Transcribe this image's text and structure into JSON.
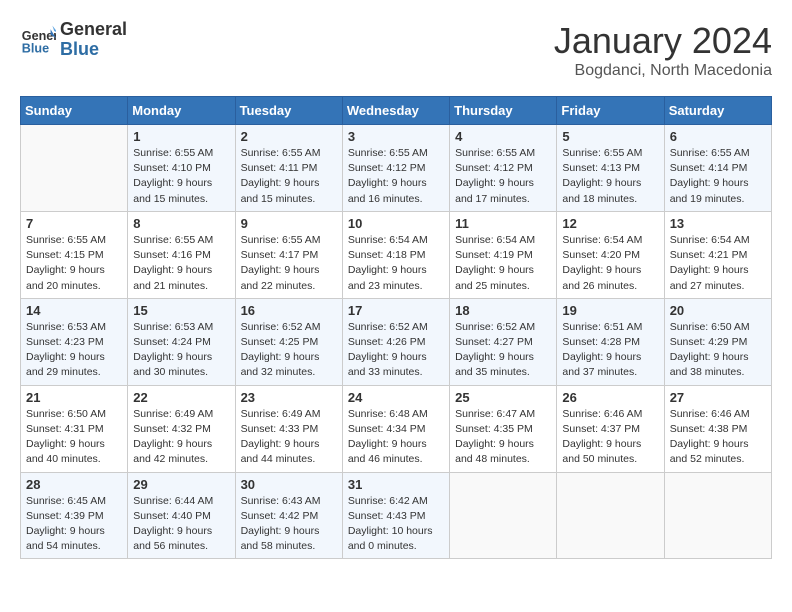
{
  "header": {
    "logo_general": "General",
    "logo_blue": "Blue",
    "title": "January 2024",
    "subtitle": "Bogdanci, North Macedonia"
  },
  "weekdays": [
    "Sunday",
    "Monday",
    "Tuesday",
    "Wednesday",
    "Thursday",
    "Friday",
    "Saturday"
  ],
  "weeks": [
    [
      {
        "day": "",
        "sunrise": "",
        "sunset": "",
        "daylight": ""
      },
      {
        "day": "1",
        "sunrise": "Sunrise: 6:55 AM",
        "sunset": "Sunset: 4:10 PM",
        "daylight": "Daylight: 9 hours and 15 minutes."
      },
      {
        "day": "2",
        "sunrise": "Sunrise: 6:55 AM",
        "sunset": "Sunset: 4:11 PM",
        "daylight": "Daylight: 9 hours and 15 minutes."
      },
      {
        "day": "3",
        "sunrise": "Sunrise: 6:55 AM",
        "sunset": "Sunset: 4:12 PM",
        "daylight": "Daylight: 9 hours and 16 minutes."
      },
      {
        "day": "4",
        "sunrise": "Sunrise: 6:55 AM",
        "sunset": "Sunset: 4:12 PM",
        "daylight": "Daylight: 9 hours and 17 minutes."
      },
      {
        "day": "5",
        "sunrise": "Sunrise: 6:55 AM",
        "sunset": "Sunset: 4:13 PM",
        "daylight": "Daylight: 9 hours and 18 minutes."
      },
      {
        "day": "6",
        "sunrise": "Sunrise: 6:55 AM",
        "sunset": "Sunset: 4:14 PM",
        "daylight": "Daylight: 9 hours and 19 minutes."
      }
    ],
    [
      {
        "day": "7",
        "sunrise": "Sunrise: 6:55 AM",
        "sunset": "Sunset: 4:15 PM",
        "daylight": "Daylight: 9 hours and 20 minutes."
      },
      {
        "day": "8",
        "sunrise": "Sunrise: 6:55 AM",
        "sunset": "Sunset: 4:16 PM",
        "daylight": "Daylight: 9 hours and 21 minutes."
      },
      {
        "day": "9",
        "sunrise": "Sunrise: 6:55 AM",
        "sunset": "Sunset: 4:17 PM",
        "daylight": "Daylight: 9 hours and 22 minutes."
      },
      {
        "day": "10",
        "sunrise": "Sunrise: 6:54 AM",
        "sunset": "Sunset: 4:18 PM",
        "daylight": "Daylight: 9 hours and 23 minutes."
      },
      {
        "day": "11",
        "sunrise": "Sunrise: 6:54 AM",
        "sunset": "Sunset: 4:19 PM",
        "daylight": "Daylight: 9 hours and 25 minutes."
      },
      {
        "day": "12",
        "sunrise": "Sunrise: 6:54 AM",
        "sunset": "Sunset: 4:20 PM",
        "daylight": "Daylight: 9 hours and 26 minutes."
      },
      {
        "day": "13",
        "sunrise": "Sunrise: 6:54 AM",
        "sunset": "Sunset: 4:21 PM",
        "daylight": "Daylight: 9 hours and 27 minutes."
      }
    ],
    [
      {
        "day": "14",
        "sunrise": "Sunrise: 6:53 AM",
        "sunset": "Sunset: 4:23 PM",
        "daylight": "Daylight: 9 hours and 29 minutes."
      },
      {
        "day": "15",
        "sunrise": "Sunrise: 6:53 AM",
        "sunset": "Sunset: 4:24 PM",
        "daylight": "Daylight: 9 hours and 30 minutes."
      },
      {
        "day": "16",
        "sunrise": "Sunrise: 6:52 AM",
        "sunset": "Sunset: 4:25 PM",
        "daylight": "Daylight: 9 hours and 32 minutes."
      },
      {
        "day": "17",
        "sunrise": "Sunrise: 6:52 AM",
        "sunset": "Sunset: 4:26 PM",
        "daylight": "Daylight: 9 hours and 33 minutes."
      },
      {
        "day": "18",
        "sunrise": "Sunrise: 6:52 AM",
        "sunset": "Sunset: 4:27 PM",
        "daylight": "Daylight: 9 hours and 35 minutes."
      },
      {
        "day": "19",
        "sunrise": "Sunrise: 6:51 AM",
        "sunset": "Sunset: 4:28 PM",
        "daylight": "Daylight: 9 hours and 37 minutes."
      },
      {
        "day": "20",
        "sunrise": "Sunrise: 6:50 AM",
        "sunset": "Sunset: 4:29 PM",
        "daylight": "Daylight: 9 hours and 38 minutes."
      }
    ],
    [
      {
        "day": "21",
        "sunrise": "Sunrise: 6:50 AM",
        "sunset": "Sunset: 4:31 PM",
        "daylight": "Daylight: 9 hours and 40 minutes."
      },
      {
        "day": "22",
        "sunrise": "Sunrise: 6:49 AM",
        "sunset": "Sunset: 4:32 PM",
        "daylight": "Daylight: 9 hours and 42 minutes."
      },
      {
        "day": "23",
        "sunrise": "Sunrise: 6:49 AM",
        "sunset": "Sunset: 4:33 PM",
        "daylight": "Daylight: 9 hours and 44 minutes."
      },
      {
        "day": "24",
        "sunrise": "Sunrise: 6:48 AM",
        "sunset": "Sunset: 4:34 PM",
        "daylight": "Daylight: 9 hours and 46 minutes."
      },
      {
        "day": "25",
        "sunrise": "Sunrise: 6:47 AM",
        "sunset": "Sunset: 4:35 PM",
        "daylight": "Daylight: 9 hours and 48 minutes."
      },
      {
        "day": "26",
        "sunrise": "Sunrise: 6:46 AM",
        "sunset": "Sunset: 4:37 PM",
        "daylight": "Daylight: 9 hours and 50 minutes."
      },
      {
        "day": "27",
        "sunrise": "Sunrise: 6:46 AM",
        "sunset": "Sunset: 4:38 PM",
        "daylight": "Daylight: 9 hours and 52 minutes."
      }
    ],
    [
      {
        "day": "28",
        "sunrise": "Sunrise: 6:45 AM",
        "sunset": "Sunset: 4:39 PM",
        "daylight": "Daylight: 9 hours and 54 minutes."
      },
      {
        "day": "29",
        "sunrise": "Sunrise: 6:44 AM",
        "sunset": "Sunset: 4:40 PM",
        "daylight": "Daylight: 9 hours and 56 minutes."
      },
      {
        "day": "30",
        "sunrise": "Sunrise: 6:43 AM",
        "sunset": "Sunset: 4:42 PM",
        "daylight": "Daylight: 9 hours and 58 minutes."
      },
      {
        "day": "31",
        "sunrise": "Sunrise: 6:42 AM",
        "sunset": "Sunset: 4:43 PM",
        "daylight": "Daylight: 10 hours and 0 minutes."
      },
      {
        "day": "",
        "sunrise": "",
        "sunset": "",
        "daylight": ""
      },
      {
        "day": "",
        "sunrise": "",
        "sunset": "",
        "daylight": ""
      },
      {
        "day": "",
        "sunrise": "",
        "sunset": "",
        "daylight": ""
      }
    ]
  ]
}
